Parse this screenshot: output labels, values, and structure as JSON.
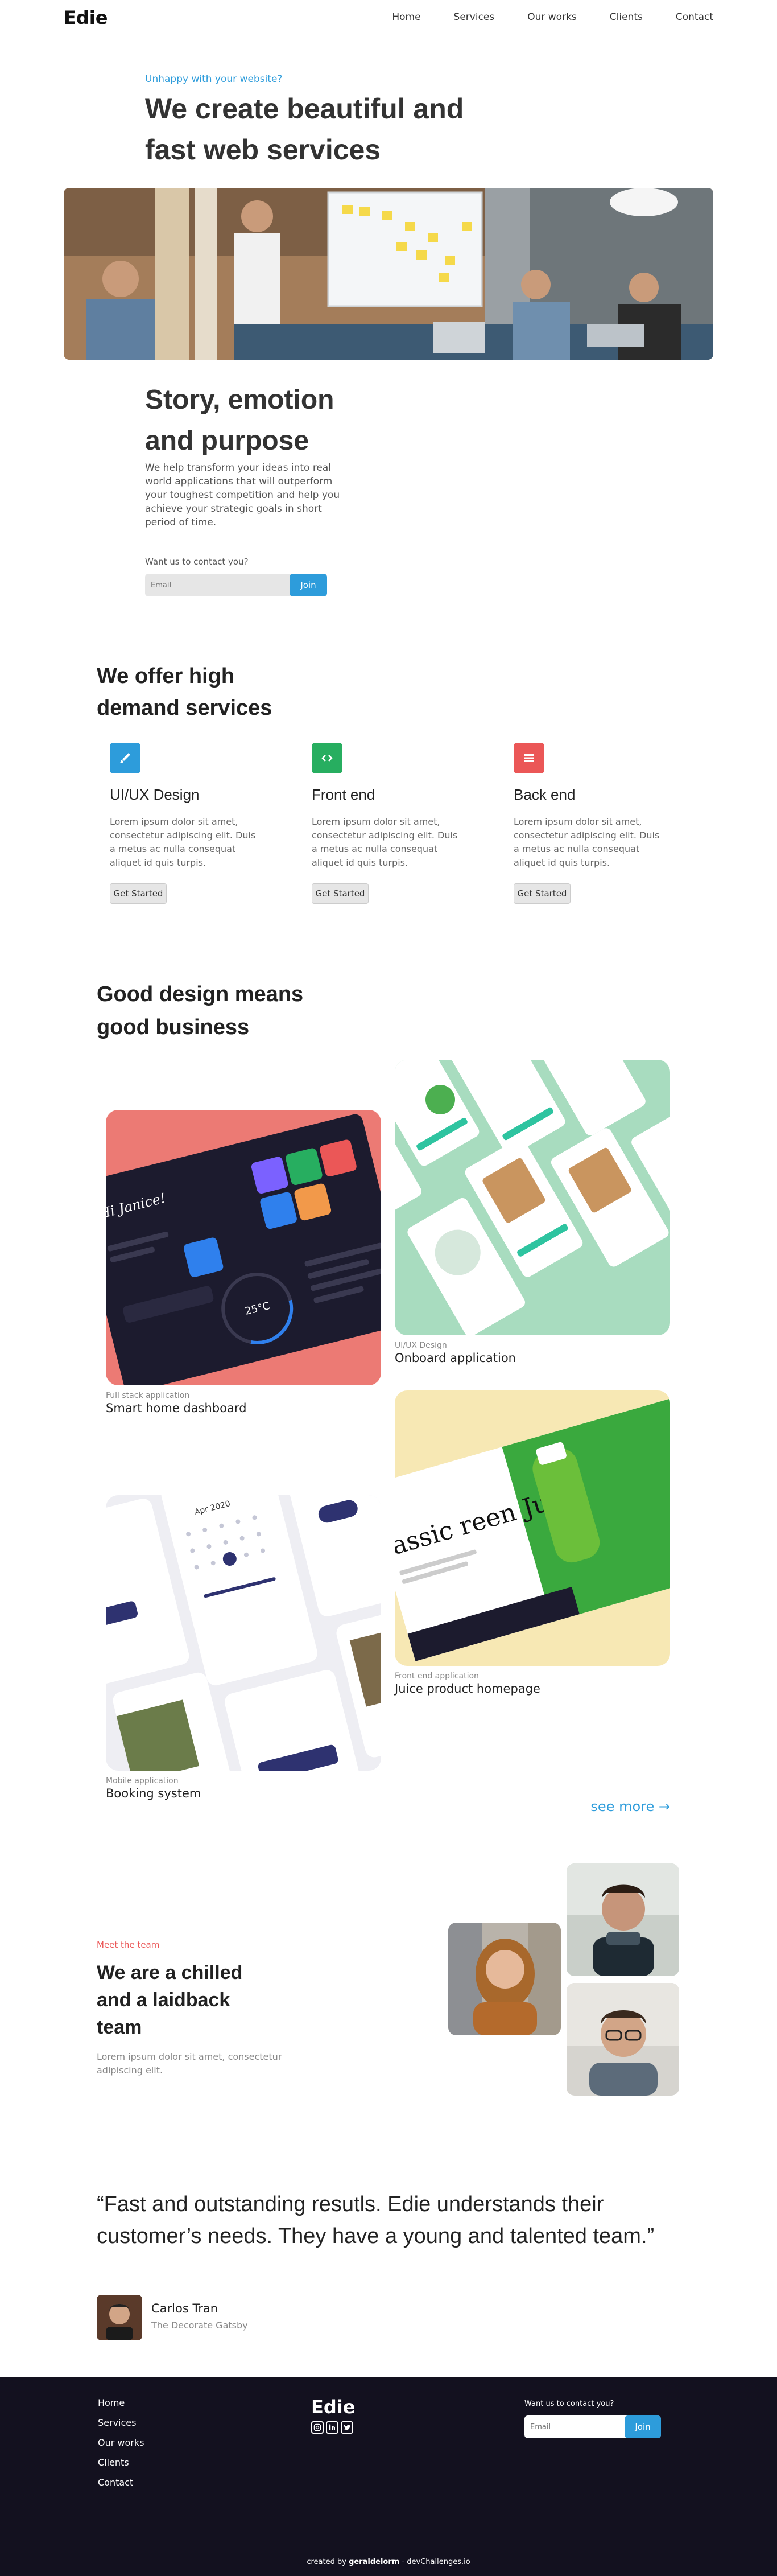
{
  "nav": {
    "logo": "Edie",
    "links": [
      "Home",
      "Services",
      "Our works",
      "Clients",
      "Contact"
    ]
  },
  "hero": {
    "eyebrow": "Unhappy with your website?",
    "title": "We create beautiful and fast web services"
  },
  "story": {
    "title": "Story, emotion and purpose",
    "text": "We help transform your ideas into real world applications that will outperform your toughest competition and help you achieve your strategic goals in short period of time.",
    "contact_label": "Want us to contact you?",
    "email_placeholder": "Email",
    "join_label": "Join"
  },
  "services": {
    "title": "We offer high demand services",
    "items": [
      {
        "icon": "brush-icon",
        "color": "#2d9cdb",
        "title": "UI/UX Design",
        "text": "Lorem ipsum dolor sit amet, consectetur adipiscing elit. Duis a metus ac nulla consequat aliquet id quis turpis.",
        "button": "Get Started"
      },
      {
        "icon": "code-icon",
        "color": "#27ae60",
        "title": "Front end",
        "text": "Lorem ipsum dolor sit amet, consectetur adipiscing elit. Duis a metus ac nulla consequat aliquet id quis turpis.",
        "button": "Get Started"
      },
      {
        "icon": "list-icon",
        "color": "#eb5757",
        "title": "Back end",
        "text": "Lorem ipsum dolor sit amet, consectetur adipiscing elit. Duis a metus ac nulla consequat aliquet id quis turpis.",
        "button": "Get Started"
      }
    ]
  },
  "works": {
    "title": "Good design means good business",
    "items": [
      {
        "category": "Full stack application",
        "name": "Smart home dashboard",
        "thumb_text": "Hi Janice!",
        "thumb_temp": "25°C"
      },
      {
        "category": "UI/UX Design",
        "name": "Onboard application"
      },
      {
        "category": "Front end application",
        "name": "Juice product homepage",
        "thumb_text": "assic reen Juice"
      },
      {
        "category": "Mobile application",
        "name": "Booking system",
        "thumb_text": "Apr 2020"
      }
    ],
    "see_more": "see more"
  },
  "team": {
    "eyebrow": "Meet the team",
    "title": "We are a chilled and a laidback team",
    "text": "Lorem ipsum dolor sit amet, consectetur adipiscing elit."
  },
  "testimonial": {
    "quote": "“Fast and outstanding resutls. Edie understands their customer’s needs. They have a young and talented team.”",
    "author": "Carlos Tran",
    "company": "The Decorate Gatsby"
  },
  "footer": {
    "links": [
      "Home",
      "Services",
      "Our works",
      "Clients",
      "Contact"
    ],
    "logo": "Edie",
    "social": [
      "instagram-icon",
      "linkedin-icon",
      "twitter-icon"
    ],
    "contact_label": "Want us to contact you?",
    "email_placeholder": "Email",
    "join_label": "Join",
    "credit_prefix": "created by",
    "credit_author": "geraldelorm",
    "credit_suffix": "- devChallenges.io"
  }
}
